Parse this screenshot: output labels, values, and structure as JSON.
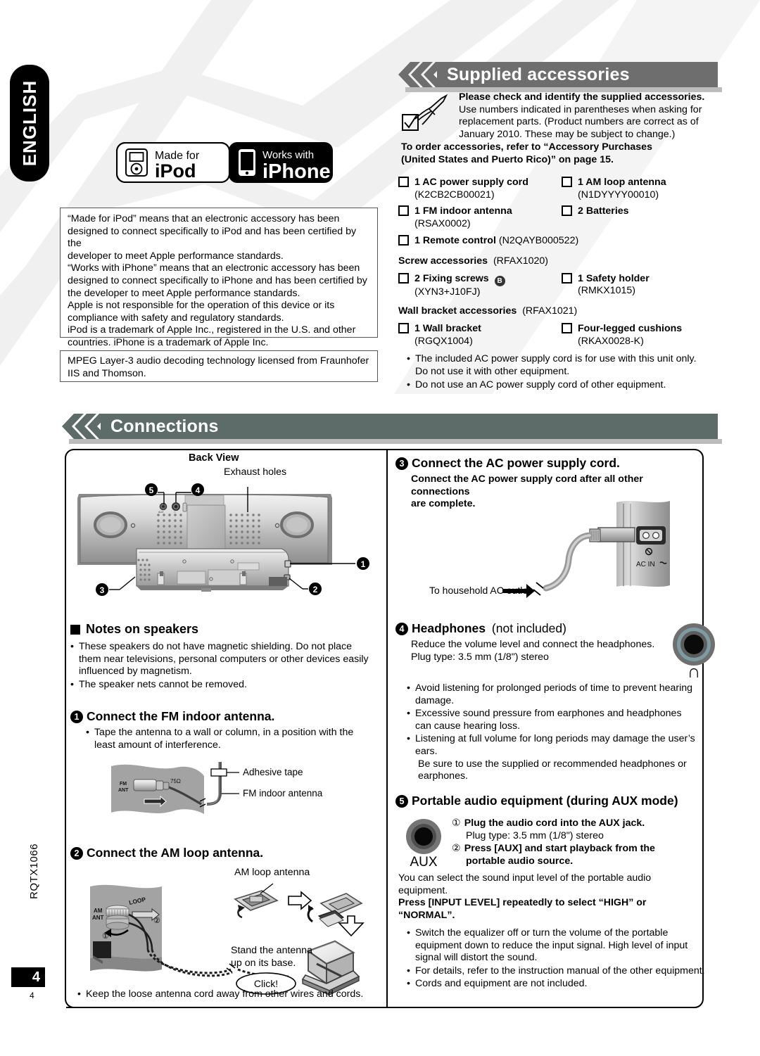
{
  "page": {
    "language_tab": "ENGLISH",
    "doc_code": "RQTX1066",
    "page_number": "4",
    "page_number_small": "4"
  },
  "colors": {
    "supplied_header_bar": "#6e6e6e",
    "connections_header_bar": "#5d6c68",
    "header_text": "#ffffff",
    "bar_shadow": "#bcbcbc",
    "ink": "#000000"
  },
  "logos": {
    "ipod": {
      "top": "Made for",
      "bottom": "iPod",
      "icon": "ipod-device-icon"
    },
    "iphone": {
      "top": "Works with",
      "bottom": "iPhone",
      "icon": "iphone-device-icon"
    }
  },
  "apple_notice": {
    "lines": [
      "“Made for iPod” means that an electronic accessory has been",
      "designed to connect specifically to iPod and has been certified by the",
      "developer to meet Apple performance standards.",
      "“Works with iPhone” means that an electronic accessory has been",
      "designed to connect specifically to iPhone and has been certified by",
      "the developer to meet Apple performance standards.",
      "Apple is not responsible for the operation of this device or its",
      "compliance with safety and regulatory standards.",
      "iPod is a trademark of Apple Inc., registered in the U.S. and other",
      "countries. iPhone is a trademark of Apple Inc."
    ]
  },
  "mpeg_notice": {
    "lines": [
      "MPEG Layer-3 audio decoding technology licensed from Fraunhofer",
      "IIS and Thomson."
    ]
  },
  "supplied": {
    "title": "Supplied accessories",
    "intro_bold": "Please check and identify the supplied accessories.",
    "intro_lines": [
      "Use numbers indicated in parentheses when asking for",
      "replacement parts. (Product numbers are correct as of",
      "January 2010. These may be subject to change.)"
    ],
    "order_lines": [
      "To order accessories, refer to “Accessory Purchases",
      "(United States and Puerto Rico)” on page 15."
    ],
    "items": [
      {
        "label": "1 AC power supply cord",
        "code": "(K2CB2CB00021)",
        "badge": ""
      },
      {
        "label": "1 AM loop antenna",
        "code": "(N1DYYYY00010)",
        "badge": ""
      },
      {
        "label": "1 FM indoor antenna",
        "code": "(RSAX0002)",
        "badge": ""
      },
      {
        "label": "2 Batteries",
        "code": "",
        "badge": ""
      }
    ],
    "remote": {
      "label": "1 Remote control",
      "code": "(N2QAYB000522)"
    },
    "screw_group": {
      "title": "Screw accessories",
      "code": "(RFAX1020)"
    },
    "screw_items": [
      {
        "label": "2 Fixing screws",
        "code": "(XYN3+J10FJ)",
        "badge": "B"
      },
      {
        "label": "1 Safety holder",
        "code": "(RMKX1015)",
        "badge": ""
      }
    ],
    "bracket_group": {
      "title": "Wall bracket accessories",
      "code": "(RFAX1021)"
    },
    "bracket_items": [
      {
        "label": "1 Wall bracket",
        "code": "(RGQX1004)",
        "badge": ""
      },
      {
        "label": "Four-legged cushions",
        "code": "(RKAX0028-K)",
        "badge": ""
      }
    ],
    "notes": [
      "The included AC power supply cord is for use with this unit only. Do not use it with other equipment.",
      "Do not use an AC power supply cord of other equipment."
    ]
  },
  "connections": {
    "title": "Connections",
    "back_view": {
      "caption": "Back View",
      "exhaust_label": "Exhaust holes",
      "callouts": [
        "1",
        "2",
        "3",
        "4",
        "5"
      ]
    },
    "notes_speakers": {
      "heading": "Notes on speakers",
      "bullets": [
        "These speakers do not have magnetic shielding. Do not place them near televisions, personal computers or other devices easily influenced by magnetism.",
        "The speaker nets cannot be removed."
      ]
    },
    "step1": {
      "num": "1",
      "heading": "Connect the FM indoor antenna.",
      "bullets": [
        "Tape the antenna to a wall or column, in a position with the least amount of interference."
      ],
      "figure": {
        "jack_label_line1": "FM",
        "jack_label_line2": "ANT",
        "impedance": "75Ω",
        "callout_tape": "Adhesive tape",
        "callout_antenna": "FM indoor antenna"
      }
    },
    "step2": {
      "num": "2",
      "heading": "Connect the AM loop antenna.",
      "figure": {
        "jack_label_line1": "AM",
        "jack_label_line2": "ANT",
        "loop_label": "LOOP",
        "antenna_label": "AM loop antenna",
        "stand_text_line1": "Stand the antenna",
        "stand_text_line2": "up on its base.",
        "click_label": "Click!",
        "marker1": "①",
        "marker2": "②"
      },
      "note": "Keep the loose antenna cord away from other wires and cords."
    },
    "step3": {
      "num": "3",
      "heading": "Connect the AC power supply cord.",
      "subtext_lines": [
        "Connect the AC power supply cord after all other connections",
        "are complete."
      ],
      "figure": {
        "ac_in_label": "AC IN",
        "outlet_label": "To household AC outlet"
      }
    },
    "step4": {
      "num": "4",
      "heading_bold": "Headphones",
      "heading_rest": "(not included)",
      "lines": [
        "Reduce the volume level and connect the headphones.",
        "Plug type: 3.5 mm (1/8\") stereo"
      ],
      "jack_icon_label": "∩",
      "bullets": [
        "Avoid listening for prolonged periods of time to prevent hearing damage.",
        "Excessive sound pressure from earphones and headphones can cause hearing loss.",
        "Listening at full volume for long periods may damage the user’s ears."
      ],
      "trailing_lines": [
        "Be sure to use the supplied or recommended headphones or",
        "earphones."
      ]
    },
    "step5": {
      "num": "5",
      "heading": "Portable audio equipment (during AUX mode)",
      "jack_label": "AUX",
      "sub_steps": [
        {
          "marker": "①",
          "bold": "Plug the audio cord into the AUX jack.",
          "plain": "Plug type: 3.5 mm (1/8\") stereo"
        },
        {
          "marker": "②",
          "bold": "Press [AUX] and start playback from the",
          "bold2": "portable audio source."
        }
      ],
      "body_lines": [
        "You can select the sound input level of the portable audio",
        "equipment."
      ],
      "body_bold_lines": [
        "Press [INPUT LEVEL] repeatedly to select “HIGH” or",
        "“NORMAL”."
      ],
      "bullets": [
        "Switch the equalizer off or turn the volume of the portable equipment down to reduce the input signal. High level of input signal will distort the sound.",
        "For details, refer to the instruction manual of the other equipment.",
        "Cords and equipment are not included."
      ]
    }
  }
}
